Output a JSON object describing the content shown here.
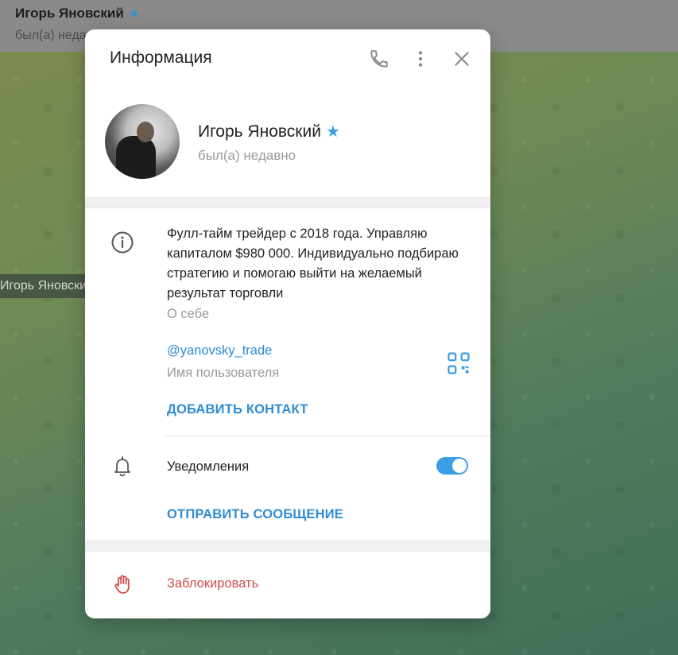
{
  "chat": {
    "title": "Игорь Яновский",
    "status": "был(а) недавно",
    "tag": "Игорь Яновский"
  },
  "modal": {
    "title": "Информация",
    "icons": {
      "call": "phone-icon",
      "more": "more-vertical-icon",
      "close": "close-icon"
    }
  },
  "profile": {
    "name": "Игорь Яновский",
    "verified_icon": "star-icon",
    "status": "был(а) недавно"
  },
  "about": {
    "text": "Фулл-тайм трейдер с 2018 года. Управляю капиталом $980 000. Индивидуально подбираю стратегию и помогаю выйти на желаемый результат торговли",
    "label": "О себе"
  },
  "username": {
    "value": "@yanovsky_trade",
    "label": "Имя пользователя"
  },
  "actions": {
    "add_contact": "ДОБАВИТЬ КОНТАКТ",
    "send_message": "ОТПРАВИТЬ СООБЩЕНИЕ",
    "block": "Заблокировать"
  },
  "notifications": {
    "label": "Уведомления",
    "enabled": true
  },
  "colors": {
    "accent": "#2e8bd4",
    "toggle": "#3a9ee4",
    "danger": "#d14b4b"
  }
}
